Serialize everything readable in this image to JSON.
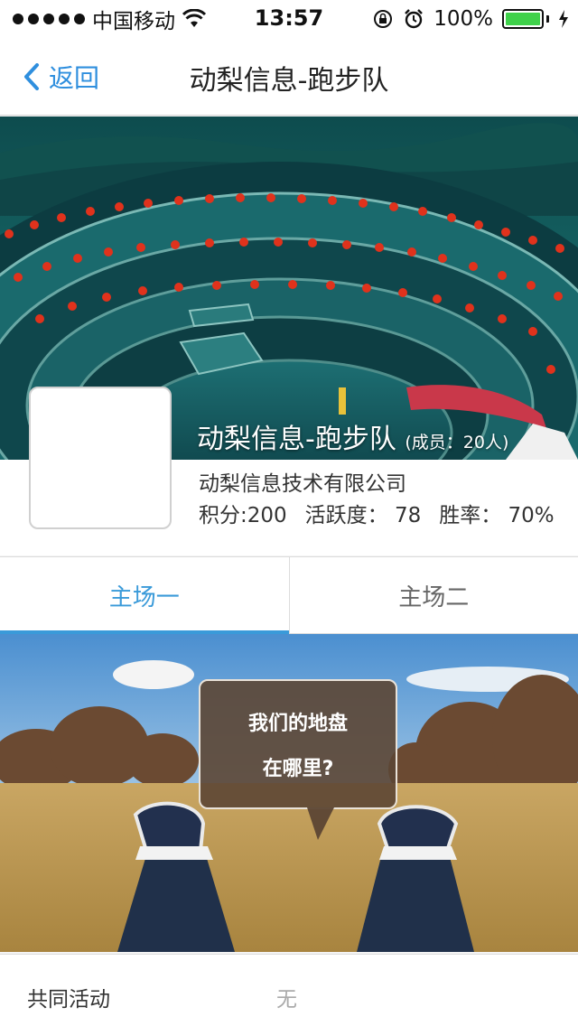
{
  "status_bar": {
    "carrier": "中国移动",
    "time": "13:57",
    "battery": "100%"
  },
  "nav": {
    "back_label": "返回",
    "title": "动梨信息-跑步队"
  },
  "team": {
    "name": "动梨信息-跑步队",
    "member_count": "(成员：20人)",
    "company": "动梨信息技术有限公司",
    "points": "积分:200",
    "activity": "活跃度：  78",
    "win_rate": "胜率：  70%"
  },
  "tabs": [
    {
      "label": "主场一",
      "active": true
    },
    {
      "label": "主场二",
      "active": false
    }
  ],
  "venue": {
    "bubble_line1": "我们的地盘",
    "bubble_line2": "在哪里?"
  },
  "shared_activity": {
    "label": "共同活动",
    "value": "无"
  },
  "colors": {
    "accent": "#3a9ad9",
    "back_link": "#2f8fde",
    "battery": "#3fd14a"
  }
}
